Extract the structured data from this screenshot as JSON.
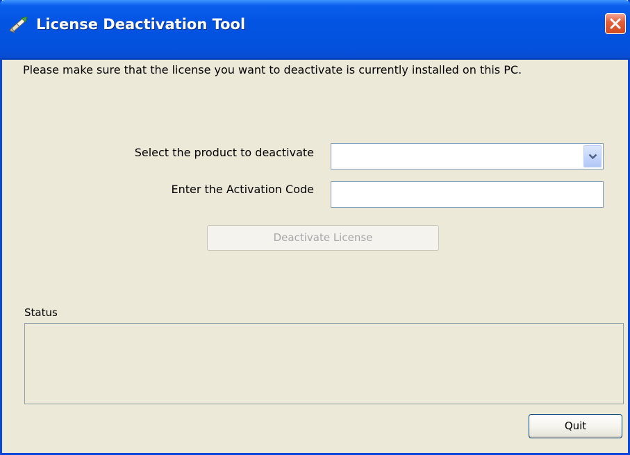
{
  "window": {
    "title": "License Deactivation Tool",
    "icon": "license-tool-icon",
    "close_icon": "close-icon"
  },
  "main": {
    "intro_text": "Please make sure that the license you want to deactivate is currently installed on this PC.",
    "product_label": "Select the product to deactivate",
    "product_value": "",
    "code_label": "Enter the Activation Code",
    "code_value": "",
    "deactivate_label": "Deactivate License",
    "status_label": "Status",
    "status_text": "",
    "quit_label": "Quit"
  },
  "colors": {
    "titlebar": "#0454e3",
    "window_bg": "#ece9d8",
    "close_button": "#d04a21",
    "disabled_text": "#a7a6aa"
  }
}
